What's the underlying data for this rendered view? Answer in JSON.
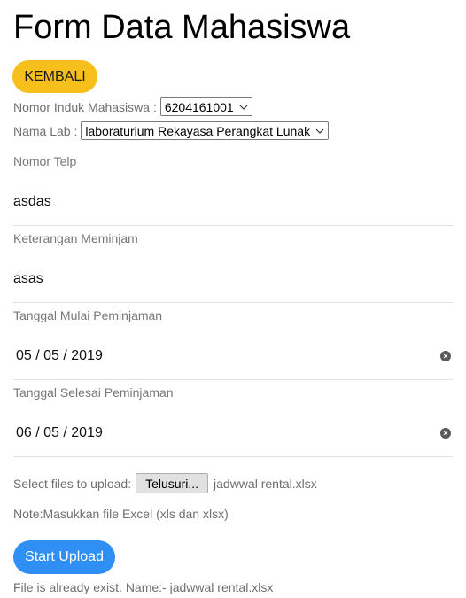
{
  "page": {
    "title": "Form Data Mahasiswa",
    "back_button": "KEMBALI"
  },
  "nim": {
    "label": "Nomor Induk Mahasiswa :",
    "selected": "6204161001"
  },
  "lab": {
    "label": "Nama Lab :",
    "selected": "laboraturium Rekayasa Perangkat Lunak"
  },
  "fields": {
    "phone": {
      "label": "Nomor Telp",
      "value": "asdas"
    },
    "note": {
      "label": "Keterangan Meminjam",
      "value": "asas"
    },
    "start_date": {
      "label": "Tanggal Mulai Peminjaman",
      "value": "05 / 05 / 2019"
    },
    "end_date": {
      "label": "Tanggal Selesai Peminjaman",
      "value": "06 / 05 / 2019"
    }
  },
  "upload": {
    "label": "Select files to upload:",
    "browse": "Telusuri...",
    "file_name": "jadwwal rental.xlsx",
    "note": "Note:Masukkan file Excel (xls dan xlsx)",
    "button": "Start Upload",
    "status": "File is already exist. Name:- jadwwal rental.xlsx"
  },
  "colors": {
    "back_button": "#f6bf1b",
    "upload_button": "#2f8ff5"
  }
}
